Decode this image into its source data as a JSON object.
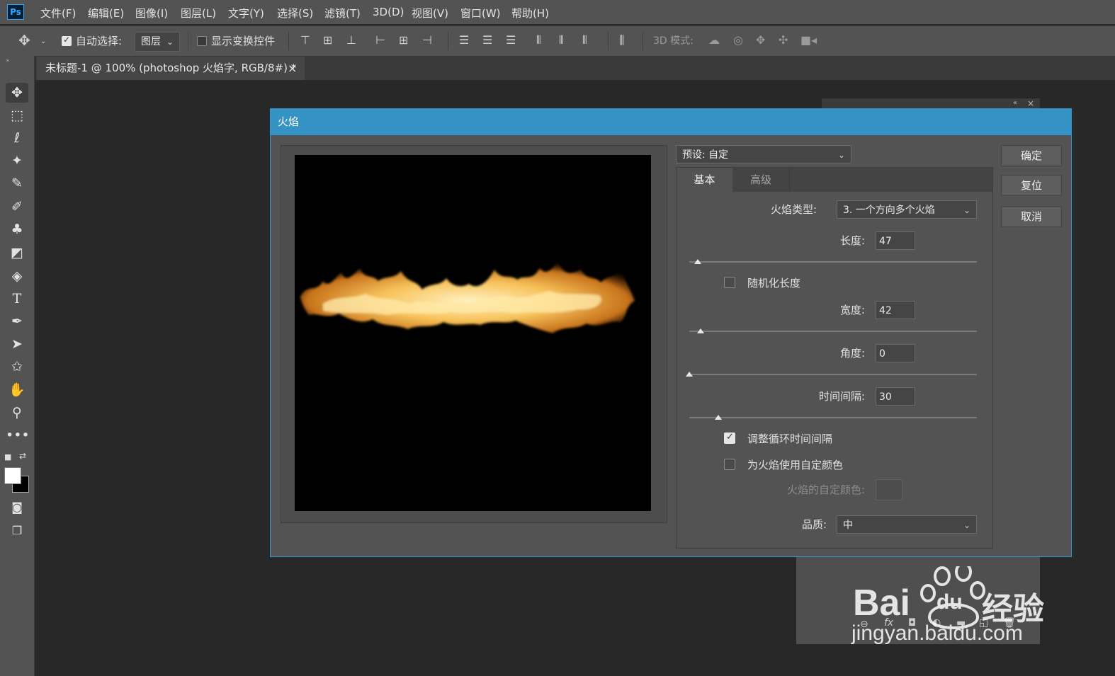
{
  "app": {
    "logo": "Ps"
  },
  "menubar": {
    "items": [
      "文件(F)",
      "编辑(E)",
      "图像(I)",
      "图层(L)",
      "文字(Y)",
      "选择(S)",
      "滤镜(T)",
      "3D(D)",
      "视图(V)",
      "窗口(W)",
      "帮助(H)"
    ]
  },
  "options": {
    "auto_select_label": "自动选择:",
    "auto_select_checked": true,
    "target_value": "图层",
    "show_transform_label": "显示变换控件",
    "show_transform_checked": false,
    "mode3d_label": "3D 模式:"
  },
  "document": {
    "tab_title": "未标题-1 @ 100% (photoshop 火焰字, RGB/8#) *",
    "close_glyph": "×"
  },
  "toolbar": {
    "icons": [
      "move-icon",
      "marquee-icon",
      "lasso-icon",
      "magic-wand-icon",
      "eyedropper-icon",
      "brush-icon",
      "clone-stamp-icon",
      "eraser-icon",
      "paint-bucket-icon",
      "type-icon",
      "pen-icon",
      "path-select-icon",
      "shape-icon",
      "hand-icon",
      "zoom-icon",
      "more-tools-icon"
    ],
    "foreground_color": "#ffffff",
    "background_color": "#000000"
  },
  "dialog": {
    "title": "火焰",
    "preset_label": "预设: 自定",
    "tabs": {
      "basic": "基本",
      "advanced": "高级"
    },
    "flame_type_label": "火焰类型:",
    "flame_type_value": "3. 一个方向多个火焰",
    "length_label": "长度:",
    "length_value": "47",
    "length_slider": 0.03,
    "randomize_length_label": "随机化长度",
    "randomize_length_checked": false,
    "width_label": "宽度:",
    "width_value": "42",
    "width_slider": 0.04,
    "angle_label": "角度:",
    "angle_value": "0",
    "angle_slider": 0.0,
    "interval_label": "时间间隔:",
    "interval_value": "30",
    "interval_slider": 0.1,
    "adjust_loop_label": "调整循环时间间隔",
    "adjust_loop_checked": true,
    "custom_color_label": "为火焰使用自定颜色",
    "custom_color_checked": false,
    "flame_color_label": "火焰的自定颜色:",
    "quality_label": "品质:",
    "quality_value": "中",
    "buttons": {
      "ok": "确定",
      "reset": "复位",
      "cancel": "取消"
    }
  },
  "watermark": {
    "brand": "Bai",
    "brand2": "du",
    "cn": "经验",
    "url": "jingyan.baidu.com"
  }
}
